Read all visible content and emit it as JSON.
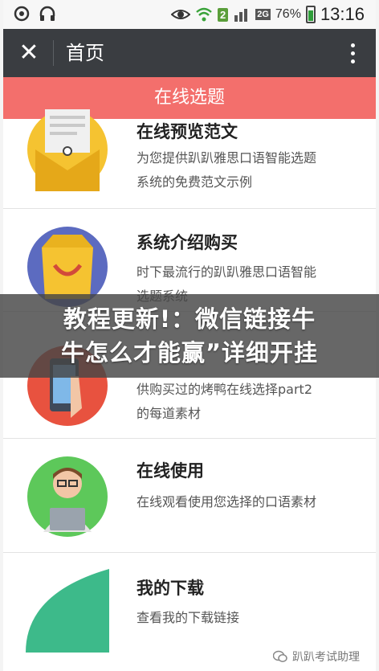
{
  "status_bar": {
    "sim_badge": "2",
    "net_label": "2G",
    "battery_percent": "76%",
    "time": "13:16"
  },
  "navbar": {
    "title": "首页"
  },
  "header": {
    "title": "在线选题"
  },
  "items": [
    {
      "title": "在线预览范文",
      "desc_lines": [
        "为您提供趴趴雅思口语智能选题",
        "系统的免费范文示例"
      ],
      "icon": "envelope-icon"
    },
    {
      "title": "系统介绍购买",
      "desc_lines": [
        "时下最流行的趴趴雅思口语智能",
        "选题系统"
      ],
      "icon": "shopping-bag-icon"
    },
    {
      "title": "",
      "desc_lines": [
        "供购买过的烤鸭在线选择part2",
        "的每道素材"
      ],
      "icon": "phone-hand-icon"
    },
    {
      "title": "在线使用",
      "desc_lines": [
        "在线观看使用您选择的口语素材"
      ],
      "icon": "user-laptop-icon"
    },
    {
      "title": "我的下载",
      "desc_lines": [
        "查看我的下载链接"
      ],
      "icon": "download-icon"
    }
  ],
  "overlay": {
    "line1": "教程更新!：微信链接牛",
    "line2": "牛怎么才能赢”详细开挂"
  },
  "watermark": {
    "text": "趴趴考试助理"
  }
}
